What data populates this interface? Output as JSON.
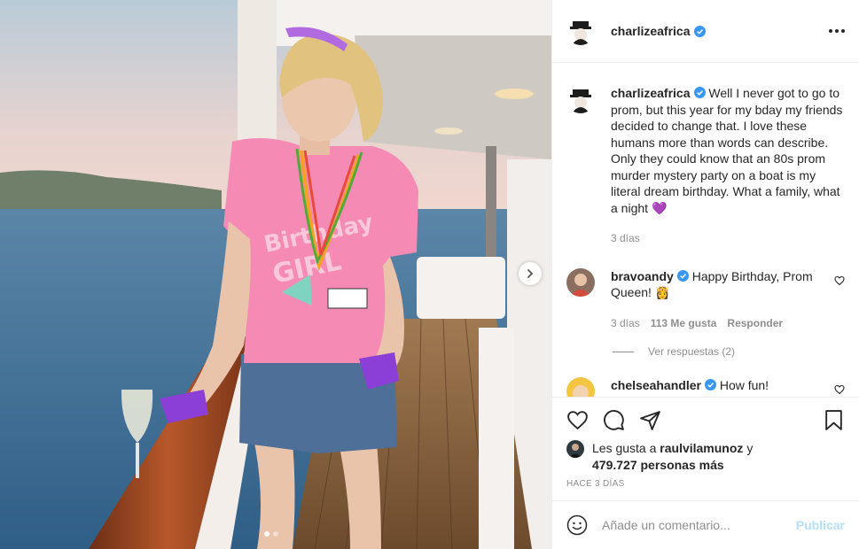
{
  "post": {
    "author": "charlizeafrica",
    "verified": true,
    "caption": "Well I never got to go to prom, but this year for my bday my friends decided to change that. I love these humans more than words can describe. Only they could know that an 80s prom murder mystery party on a boat is my literal dream birthday. What a family, what a night",
    "caption_emoji": "💜",
    "caption_time": "3 días"
  },
  "comments": [
    {
      "user": "bravoandy",
      "verified": true,
      "text": "Happy Birthday, Prom Queen! 👸",
      "time": "3 días",
      "likes": "113 Me gusta",
      "reply_label": "Responder",
      "view_replies": "Ver respuestas (2)"
    },
    {
      "user": "chelseahandler",
      "verified": true,
      "text": "How fun!"
    }
  ],
  "likes": {
    "prefix": "Les gusta a",
    "user": "raulvilamunoz",
    "connector": "y",
    "others": "479.727 personas más"
  },
  "timestamp": "HACE 3 DÍAS",
  "add_comment": {
    "placeholder": "Añade un comentario...",
    "publish": "Publicar"
  },
  "carousel": {
    "current_index": 1,
    "total": 2
  },
  "colors": {
    "verified": "#3897f0",
    "publish_disabled": "#b2dffc",
    "muted_text": "#8e8e8e",
    "border": "#efefef",
    "shirt_pink": "#f58bb4"
  },
  "icons": [
    "more-icon",
    "heart-icon",
    "comment-icon",
    "share-icon",
    "bookmark-icon",
    "emoji-icon",
    "chevron-right-icon",
    "verified-badge-icon"
  ]
}
